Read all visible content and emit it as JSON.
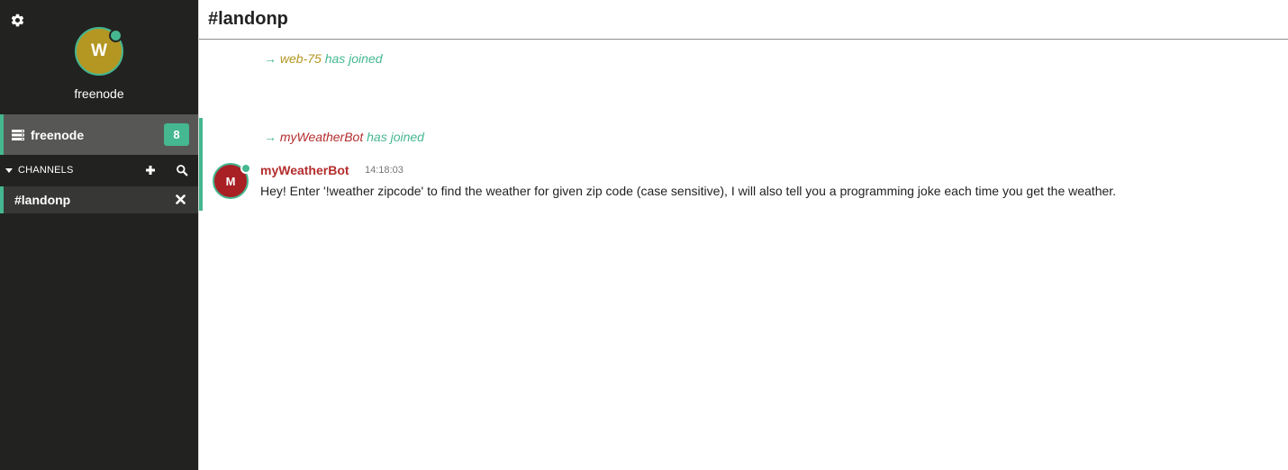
{
  "sidebar": {
    "settings_icon": "gear-icon",
    "user": {
      "initial": "W",
      "name": "freenode",
      "avatar_color": "#b49722",
      "presence_color": "#45b791"
    },
    "server": {
      "name": "freenode",
      "icon": "server-list-icon",
      "badge": "8"
    },
    "channels_header": {
      "label": "CHANNELS",
      "add_icon": "plus-icon",
      "search_icon": "search-icon"
    },
    "channels": [
      {
        "name": "#landonp",
        "close_icon": "close-icon"
      }
    ]
  },
  "main": {
    "title": "#landonp",
    "events": [
      {
        "arrow": "→",
        "nick": "web-75",
        "text": "has joined"
      },
      {
        "arrow": "→",
        "nick": "myWeatherBot",
        "text": "has joined"
      }
    ],
    "messages": [
      {
        "avatar_initial": "M",
        "author": "myWeatherBot",
        "time": "14:18:03",
        "text": "Hey! Enter '!weather zipcode' to find the weather for given zip code (case sensitive), I will also tell you a programming joke each time you get the weather."
      }
    ]
  },
  "colors": {
    "accent": "#45b791",
    "sidebar_bg": "#222320",
    "nick_yellow": "#b49722",
    "nick_red": "#b42d2d"
  }
}
